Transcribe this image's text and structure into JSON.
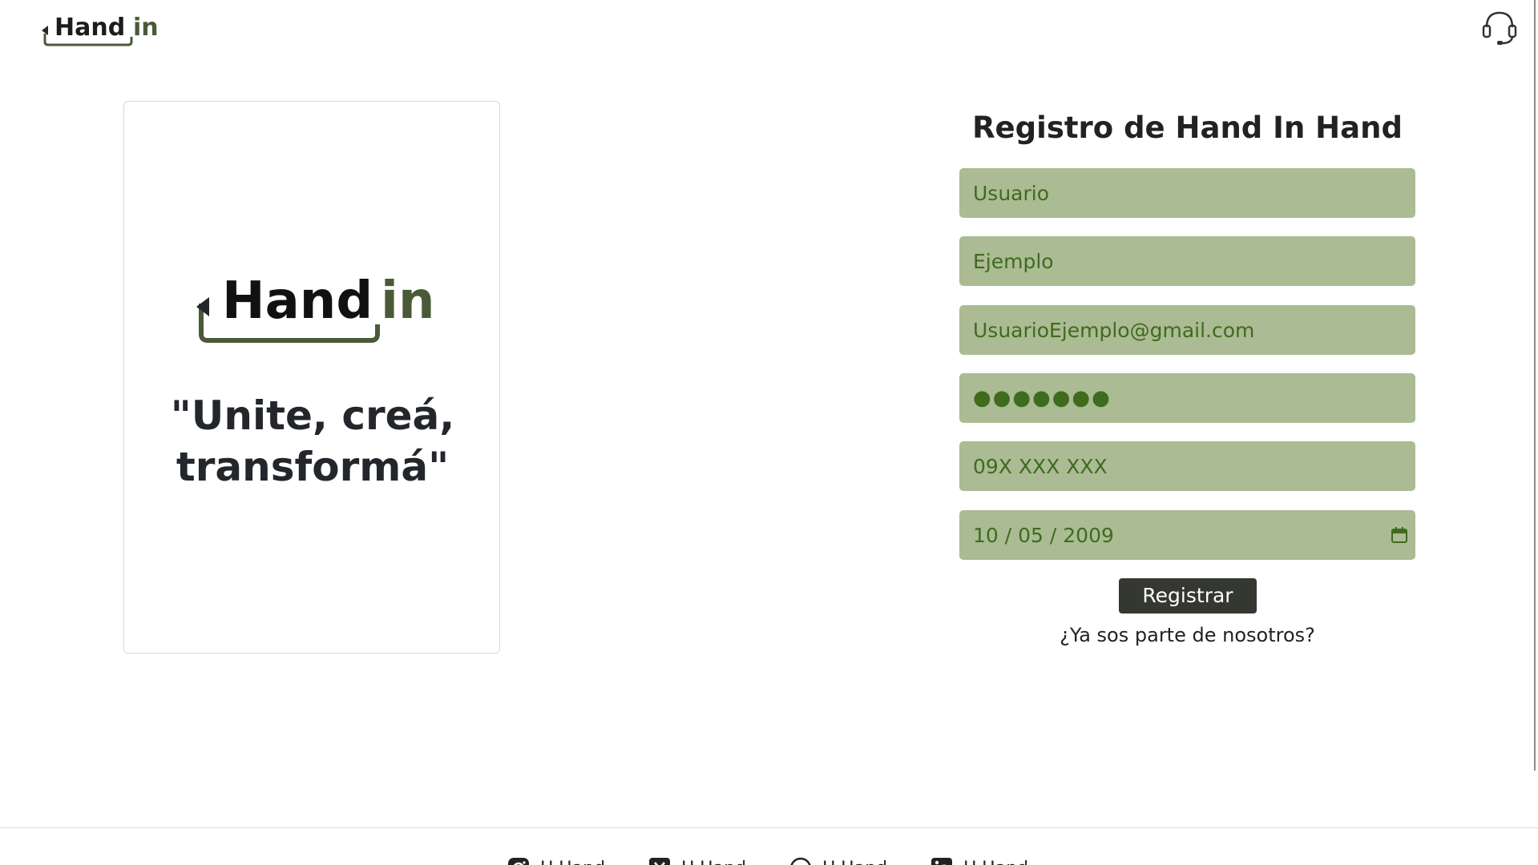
{
  "header": {
    "brand_text": "Hand",
    "brand_suffix": "in",
    "support_icon": "headset-icon"
  },
  "hero": {
    "brand_text": "Hand",
    "brand_suffix": "in",
    "slogan": "\"Unite, creá, transformá\""
  },
  "form": {
    "title": "Registro de Hand In Hand",
    "fields": {
      "username": {
        "value": "Usuario"
      },
      "name": {
        "value": "Ejemplo"
      },
      "email": {
        "value": "UsuarioEjemplo@gmail.com"
      },
      "password": {
        "value": "●●●●●●●"
      },
      "phone": {
        "value": "09X XXX XXX"
      },
      "birthdate": {
        "value": "10 / 05 / 2009",
        "icon": "calendar-icon"
      }
    },
    "submit_label": "Registrar",
    "login_link": "¿Ya sos parte de nosotros?"
  },
  "footer": {
    "social": [
      {
        "icon": "instagram-icon",
        "label": "H.Hand"
      },
      {
        "icon": "x-icon",
        "label": "H.Hand"
      },
      {
        "icon": "whatsapp-icon",
        "label": "H.Hand"
      },
      {
        "icon": "linkedin-icon",
        "label": "H.Hand"
      }
    ]
  },
  "colors": {
    "field_bg": "#abbb93",
    "field_text": "#3f6b1e",
    "button_bg": "#353830",
    "brand_green": "#4a5a38"
  }
}
